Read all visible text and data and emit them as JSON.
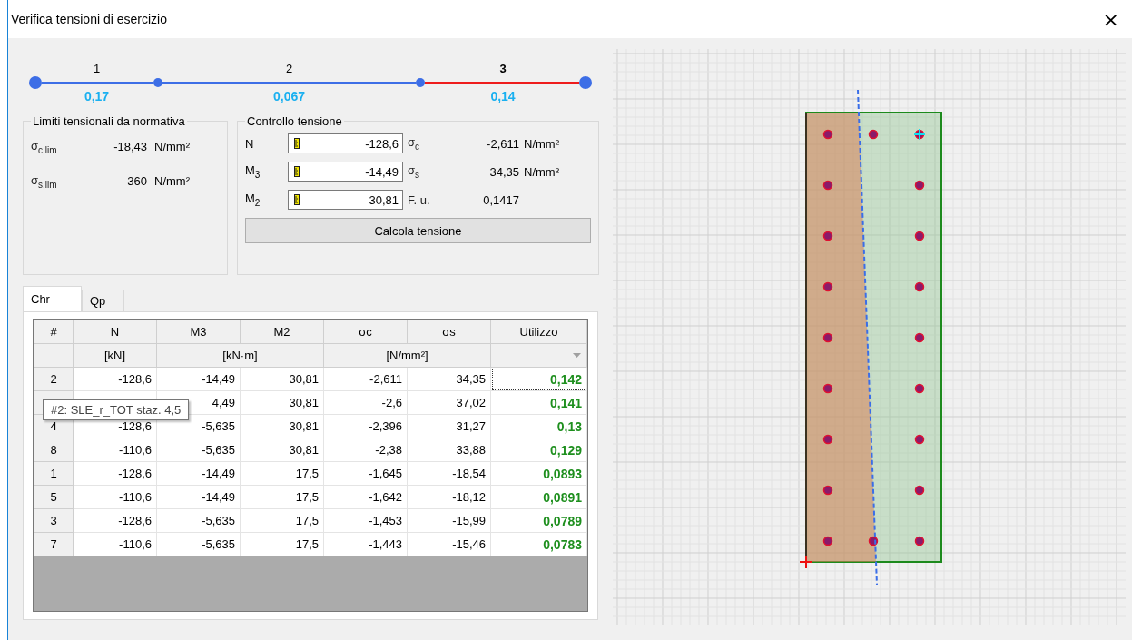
{
  "window": {
    "title": "Verifica tensioni di esercizio",
    "close": "×"
  },
  "steps": [
    {
      "label": "1",
      "value": "0,17",
      "selected": false
    },
    {
      "label": "2",
      "value": "0,067",
      "selected": false
    },
    {
      "label": "3",
      "value": "0,14",
      "selected": true
    }
  ],
  "limits": {
    "title": "Limiti tensionali da normativa",
    "rows": [
      {
        "symbol": "σ$_{c,lim}$",
        "value": "-18,43",
        "unit": "N/mm²"
      },
      {
        "symbol": "σ$_{s,lim}$",
        "value": "360",
        "unit": "N/mm²"
      }
    ]
  },
  "control": {
    "title": "Controllo tensione",
    "rows": [
      {
        "label": "N",
        "value": "-128,6",
        "result_symbol": "σ$_{c}$",
        "result": "-2,611",
        "unit": "N/mm²"
      },
      {
        "label": "M$_{3}$",
        "value": "-14,49",
        "result_symbol": "σ$_{s}$",
        "result": "34,35",
        "unit": "N/mm²"
      },
      {
        "label": "M$_{2}$",
        "value": "30,81",
        "result_symbol": "F. u.",
        "result": "0,1417"
      }
    ],
    "button": "Calcola tensione"
  },
  "tabs": [
    {
      "label": "Chr",
      "selected": true
    },
    {
      "label": "Qp",
      "selected": false
    }
  ],
  "table": {
    "columns": [
      {
        "label": "#"
      },
      {
        "label": "N",
        "unit": "[kN]"
      },
      {
        "label": "M3",
        "unit": "[kN·m]"
      },
      {
        "label": "M2",
        "joined": true
      },
      {
        "label": "σc",
        "unit": "[N/mm²]"
      },
      {
        "label": "σs",
        "joined": true
      },
      {
        "label": "Utilizzo",
        "filter": true
      }
    ],
    "rows": [
      {
        "cells": [
          "2",
          "-128,6",
          "-14,49",
          "30,81",
          "-2,611",
          "34,35",
          "0,142"
        ],
        "focused": true
      },
      {
        "cells": [
          null,
          null,
          "4,49",
          "30,81",
          "-2,6",
          "37,02",
          "0,141"
        ],
        "focused": false
      },
      {
        "cells": [
          "4",
          "-128,6",
          "-5,635",
          "30,81",
          "-2,396",
          "31,27",
          "0,13"
        ],
        "focused": false
      },
      {
        "cells": [
          "8",
          "-110,6",
          "-5,635",
          "30,81",
          "-2,38",
          "33,88",
          "0,129"
        ],
        "focused": false
      },
      {
        "cells": [
          "1",
          "-128,6",
          "-14,49",
          "17,5",
          "-1,645",
          "-18,54",
          "0,0893"
        ],
        "focused": false
      },
      {
        "cells": [
          "5",
          "-110,6",
          "-14,49",
          "17,5",
          "-1,642",
          "-18,12",
          "0,0891"
        ],
        "focused": false
      },
      {
        "cells": [
          "3",
          "-128,6",
          "-5,635",
          "17,5",
          "-1,453",
          "-15,99",
          "0,0789"
        ],
        "focused": false
      },
      {
        "cells": [
          "7",
          "-110,6",
          "-5,635",
          "17,5",
          "-1,443",
          "-15,46",
          "0,0783"
        ],
        "focused": false
      }
    ],
    "tooltip": "#2: SLE_r_TOT staz. 4,5"
  }
}
